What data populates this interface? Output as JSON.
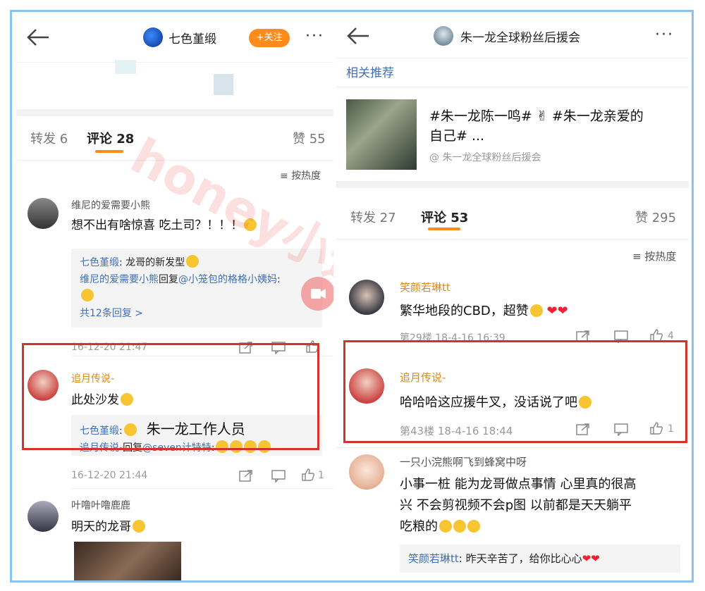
{
  "left": {
    "header": {
      "title": "七色堇缎",
      "follow_label": "+关注",
      "more": "···"
    },
    "tabs": {
      "repost": "转发 6",
      "comments": "评论 28",
      "likes": "赞 55"
    },
    "sort_label": "按热度",
    "comments": [
      {
        "name": "维尼的爱需要小熊",
        "text": "想不出有啥惊喜 吃土司？！！！",
        "reply1_name": "七色堇缎",
        "reply1_text": ": 龙哥的新发型",
        "reply2_name": "维尼的爱需要小熊",
        "reply2_mid": "回复",
        "reply2_target": "@小笼包的格格小姨妈",
        "reply2_tail": ":",
        "more_replies": "共12条回复 >",
        "time": "16-12-20 21:47"
      },
      {
        "name": "追月传说-",
        "text": "此处沙发",
        "reply1_name": "七色堇缎",
        "reply1_colon": ":",
        "annotation": "朱一龙工作人员",
        "reply2_name": "追月传说-",
        "reply2_mid": "回复",
        "reply2_target": "@seven计特特",
        "reply2_tail": ":",
        "time": "16-12-20 21:44",
        "likes": "1"
      },
      {
        "name": "叶噜叶噜鹿鹿",
        "text": "明天的龙哥"
      }
    ]
  },
  "right": {
    "header": {
      "title": "朱一龙全球粉丝后援会",
      "more": "···"
    },
    "related_title": "相关推荐",
    "related": {
      "text_line1": "#朱一龙陈一鸣# ✌ #朱一龙亲爱的",
      "text_line2": "自己# ...",
      "source": "@ 朱一龙全球粉丝后援会"
    },
    "tabs": {
      "repost": "转发 27",
      "comments": "评论 53",
      "likes": "赞 295"
    },
    "sort_label": "按热度",
    "comments": [
      {
        "name": "笑颜若琳tt",
        "text": "繁华地段的CBD，超赞",
        "meta": "第29楼 18-4-16 16:39",
        "likes": "4"
      },
      {
        "name": "追月传说-",
        "text": "哈哈哈这应援牛叉，没话说了吧",
        "meta": "第43楼 18-4-16 18:44",
        "likes": "1"
      },
      {
        "name": "一只小浣熊啊飞到蜂窝中呀",
        "text_line1": "小事一桩  能为龙哥做点事情  心里真的很高",
        "text_line2": "兴  不会剪视频不会p图  以前都是天天躺平",
        "text_line3": "吃粮的",
        "reply_name": "笑颜若琳tt",
        "reply_text": ": 昨天辛苦了，给你比心心"
      }
    ]
  },
  "watermark": "honey小透明",
  "colors": {
    "accent": "#ff8c1a",
    "link": "#3f6fb5",
    "highlight_box": "#d0342c",
    "frame": "#88c4ee"
  }
}
